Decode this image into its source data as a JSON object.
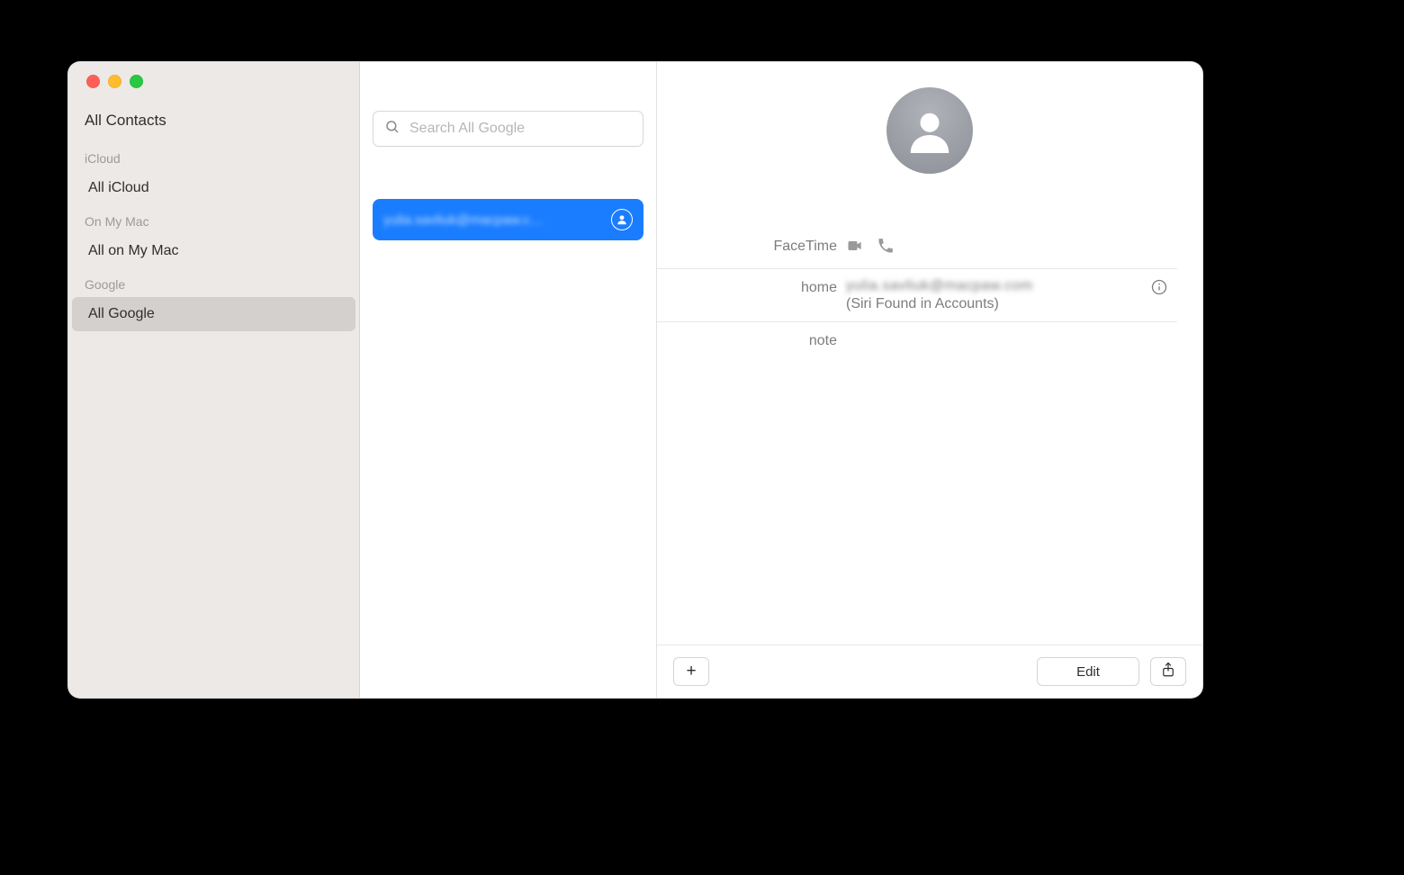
{
  "sidebar": {
    "all_contacts_label": "All Contacts",
    "sections": [
      {
        "label": "iCloud",
        "item": "All iCloud",
        "selected": false
      },
      {
        "label": "On My Mac",
        "item": "All on My Mac",
        "selected": false
      },
      {
        "label": "Google",
        "item": "All Google",
        "selected": true
      }
    ]
  },
  "search": {
    "placeholder": "Search All Google",
    "value": ""
  },
  "contacts": [
    {
      "display": "yulia.savliuk@macpaw.c…",
      "selected": true,
      "is_me": true
    }
  ],
  "detail": {
    "facetime_label": "FaceTime",
    "rows": {
      "home_label": "home",
      "home_value_masked": "yulia.savliuk@macpaw.com",
      "home_siri_note": "(Siri Found in Accounts)",
      "note_label": "note"
    }
  },
  "footer": {
    "add_icon": "+",
    "edit_label": "Edit"
  }
}
